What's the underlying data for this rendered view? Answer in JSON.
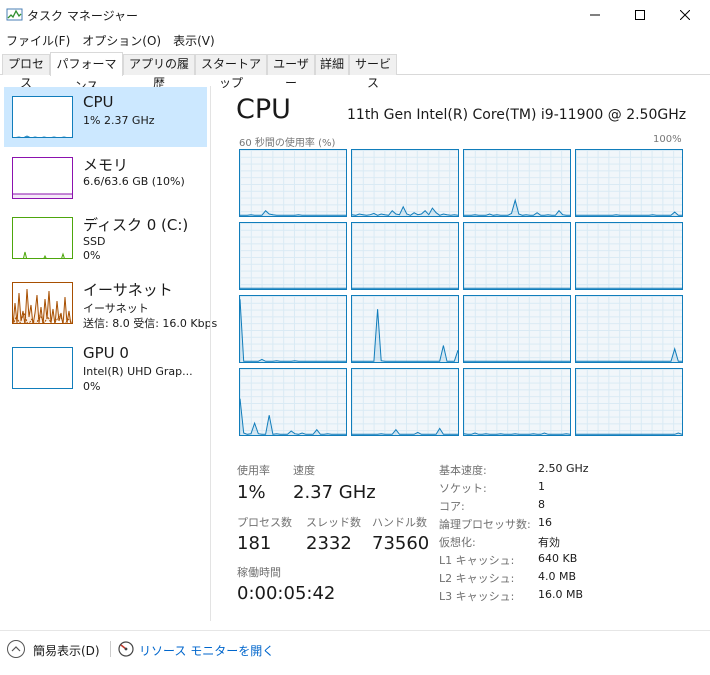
{
  "window": {
    "title": "タスク マネージャー"
  },
  "menu": [
    "ファイル(F)",
    "オプション(O)",
    "表示(V)"
  ],
  "tabs": [
    "プロセス",
    "パフォーマンス",
    "アプリの履歴",
    "スタートアップ",
    "ユーザー",
    "詳細",
    "サービス"
  ],
  "active_tab": "パフォーマンス",
  "resources": [
    {
      "name": "CPU",
      "line1": "1%  2.37 GHz",
      "line2": "",
      "line3": "",
      "color": "#117dbb",
      "selected": true
    },
    {
      "name": "メモリ",
      "line1": "6.6/63.6 GB (10%)",
      "line2": "",
      "line3": "",
      "color": "#8b12ae",
      "selected": false
    },
    {
      "name": "ディスク 0 (C:)",
      "line1": "SSD",
      "line2": "0%",
      "line3": "",
      "color": "#4da60c",
      "selected": false
    },
    {
      "name": "イーサネット",
      "line1": "イーサネット",
      "line2": "送信: 8.0  受信: 16.0 Kbps",
      "line3": "",
      "color": "#a74f01",
      "selected": false
    },
    {
      "name": "GPU 0",
      "line1": "Intel(R) UHD Grap...",
      "line2": "0%",
      "line3": "",
      "color": "#117dbb",
      "selected": false
    }
  ],
  "detail": {
    "title": "CPU",
    "model": "11th Gen Intel(R) Core(TM) i9-11900 @ 2.50GHz",
    "graph_label_left": "60 秒間の使用率 (%)",
    "graph_label_right": "100%",
    "graph_accent": "#117dbb",
    "core_graphs": [
      [
        1,
        1,
        1,
        2,
        1,
        1,
        1,
        8,
        3,
        2,
        1,
        1,
        1,
        1,
        1,
        1,
        2,
        1,
        1,
        1,
        1,
        1,
        1,
        1,
        1,
        1,
        1,
        1,
        1,
        1
      ],
      [
        2,
        1,
        3,
        2,
        1,
        2,
        4,
        1,
        3,
        2,
        1,
        8,
        3,
        2,
        14,
        3,
        1,
        5,
        2,
        3,
        8,
        2,
        12,
        5,
        1,
        3,
        2,
        1,
        2,
        1
      ],
      [
        1,
        1,
        1,
        2,
        1,
        1,
        1,
        3,
        1,
        2,
        1,
        1,
        1,
        4,
        24,
        3,
        1,
        2,
        1,
        1,
        5,
        1,
        1,
        2,
        1,
        1,
        8,
        2,
        1,
        1
      ],
      [
        1,
        1,
        1,
        1,
        1,
        1,
        1,
        1,
        1,
        1,
        1,
        2,
        1,
        1,
        1,
        1,
        1,
        1,
        1,
        1,
        1,
        2,
        1,
        1,
        1,
        1,
        1,
        6,
        1,
        1
      ],
      [
        1,
        1,
        1,
        1,
        1,
        1,
        1,
        1,
        1,
        1,
        1,
        1,
        1,
        1,
        1,
        1,
        1,
        1,
        1,
        1,
        1,
        1,
        1,
        1,
        1,
        1,
        1,
        1,
        1,
        1
      ],
      [
        1,
        1,
        1,
        1,
        1,
        1,
        1,
        1,
        1,
        1,
        1,
        1,
        1,
        1,
        1,
        1,
        1,
        1,
        1,
        1,
        1,
        1,
        1,
        1,
        1,
        1,
        1,
        1,
        1,
        1
      ],
      [
        1,
        1,
        1,
        1,
        1,
        1,
        1,
        1,
        1,
        1,
        1,
        1,
        1,
        1,
        1,
        1,
        1,
        1,
        1,
        1,
        1,
        1,
        1,
        1,
        1,
        1,
        1,
        1,
        1,
        1
      ],
      [
        1,
        1,
        1,
        1,
        1,
        1,
        1,
        1,
        1,
        1,
        1,
        1,
        1,
        1,
        1,
        1,
        1,
        1,
        1,
        1,
        1,
        1,
        1,
        1,
        1,
        1,
        1,
        1,
        1,
        1
      ],
      [
        95,
        1,
        1,
        1,
        1,
        1,
        4,
        1,
        1,
        1,
        2,
        1,
        1,
        1,
        1,
        2,
        1,
        1,
        1,
        1,
        1,
        1,
        1,
        1,
        1,
        1,
        1,
        1,
        1,
        1
      ],
      [
        1,
        1,
        1,
        1,
        1,
        1,
        1,
        80,
        2,
        1,
        1,
        1,
        1,
        1,
        1,
        1,
        1,
        1,
        1,
        1,
        1,
        1,
        1,
        1,
        1,
        25,
        1,
        1,
        1,
        18
      ],
      [
        1,
        1,
        1,
        1,
        1,
        1,
        1,
        1,
        1,
        1,
        1,
        1,
        1,
        1,
        1,
        1,
        1,
        1,
        1,
        1,
        1,
        1,
        1,
        1,
        1,
        1,
        1,
        1,
        1,
        1
      ],
      [
        1,
        1,
        1,
        1,
        1,
        1,
        1,
        1,
        1,
        1,
        1,
        1,
        1,
        1,
        1,
        1,
        1,
        1,
        1,
        1,
        1,
        1,
        1,
        1,
        1,
        1,
        1,
        20,
        1,
        1
      ],
      [
        55,
        3,
        1,
        2,
        18,
        2,
        1,
        1,
        30,
        1,
        2,
        1,
        1,
        1,
        6,
        2,
        1,
        3,
        1,
        1,
        1,
        8,
        1,
        1,
        2,
        1,
        1,
        1,
        1,
        1
      ],
      [
        1,
        1,
        1,
        1,
        1,
        1,
        1,
        1,
        2,
        1,
        1,
        1,
        8,
        1,
        1,
        1,
        1,
        1,
        4,
        1,
        1,
        1,
        1,
        1,
        10,
        1,
        1,
        1,
        1,
        1
      ],
      [
        2,
        1,
        1,
        3,
        1,
        1,
        2,
        1,
        1,
        1,
        2,
        1,
        1,
        1,
        2,
        1,
        1,
        1,
        1,
        2,
        1,
        1,
        3,
        1,
        1,
        1,
        1,
        1,
        2,
        1
      ],
      [
        1,
        1,
        1,
        1,
        1,
        1,
        1,
        1,
        1,
        1,
        1,
        1,
        1,
        1,
        1,
        1,
        1,
        1,
        1,
        1,
        1,
        1,
        1,
        1,
        1,
        1,
        1,
        1,
        3,
        1
      ]
    ],
    "stats": {
      "utilization_label": "使用率",
      "utilization": "1%",
      "speed_label": "速度",
      "speed": "2.37 GHz",
      "processes_label": "プロセス数",
      "processes": "181",
      "threads_label": "スレッド数",
      "threads": "2332",
      "handles_label": "ハンドル数",
      "handles": "73560",
      "uptime_label": "稼働時間",
      "uptime": "0:00:05:42"
    },
    "specs": [
      {
        "k": "基本速度:",
        "v": "2.50 GHz"
      },
      {
        "k": "ソケット:",
        "v": "1"
      },
      {
        "k": "コア:",
        "v": "8"
      },
      {
        "k": "論理プロセッサ数:",
        "v": "16"
      },
      {
        "k": "仮想化:",
        "v": "有効"
      },
      {
        "k": "L1 キャッシュ:",
        "v": "640 KB"
      },
      {
        "k": "L2 キャッシュ:",
        "v": "4.0 MB"
      },
      {
        "k": "L3 キャッシュ:",
        "v": "16.0 MB"
      }
    ]
  },
  "footer": {
    "fewer_details": "簡易表示(D)",
    "resource_monitor": "リソース モニターを開く"
  }
}
